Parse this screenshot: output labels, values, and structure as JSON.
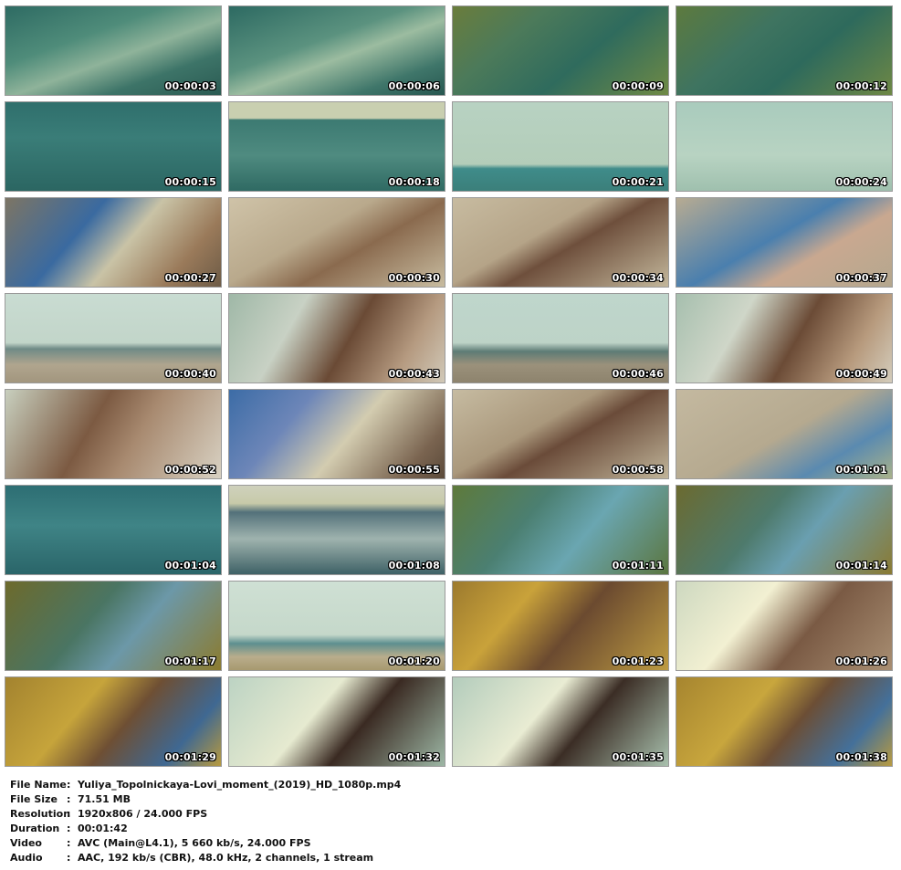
{
  "thumbnails": [
    {
      "timestamp": "00:00:03",
      "bg": "linear-gradient(160deg,#2e6b63 0%,#4f8c7a 35%,#8fb39a 55%,#3d7468 75%,#2a5a52 100%)"
    },
    {
      "timestamp": "00:00:06",
      "bg": "linear-gradient(160deg,#2d6a62 0%,#5b927f 40%,#9cbca0 55%,#3f766a 80%,#275750 100%)"
    },
    {
      "timestamp": "00:00:09",
      "bg": "linear-gradient(140deg,#6a7d3c 0%,#4c7a5a 30%,#2f6b5d 60%,#6f8a45 100%)"
    },
    {
      "timestamp": "00:00:12",
      "bg": "linear-gradient(140deg,#5d7a3e 0%,#3f7460 35%,#2e6a5c 60%,#6e8845 100%)"
    },
    {
      "timestamp": "00:00:15",
      "bg": "linear-gradient(180deg,#2f6f6c 0%,#3a7d78 40%,#2b6662 100%)"
    },
    {
      "timestamp": "00:00:18",
      "bg": "linear-gradient(180deg,#c9cfb0 0%,#c9cfb0 18%,#3c7a72 20%,#4f8b80 60%,#2f6a63 100%)"
    },
    {
      "timestamp": "00:00:21",
      "bg": "linear-gradient(180deg,#b8d2c2 0%,#b3cdb9 70%,#3f8c8a 75%,#3b7f7a 100%)"
    },
    {
      "timestamp": "00:00:24",
      "bg": "linear-gradient(180deg,#a9cbbd 0%,#b8d3c2 60%,#9fc0ae 100%)"
    },
    {
      "timestamp": "00:00:27",
      "bg": "linear-gradient(130deg,#7d7564 0%,#3a6aa0 35%,#c9c3a6 55%,#9a7a5a 80%,#6d5b46 100%)"
    },
    {
      "timestamp": "00:00:30",
      "bg": "linear-gradient(150deg,#cfc3a8 0%,#b9a98c 40%,#8a6a4e 60%,#c8bca0 100%)"
    },
    {
      "timestamp": "00:00:34",
      "bg": "linear-gradient(150deg,#c7bba0 0%,#b5a488 40%,#6e4f3c 55%,#c3b79b 100%)"
    },
    {
      "timestamp": "00:00:37",
      "bg": "linear-gradient(150deg,#b7ab92 0%,#4a7fae 45%,#c9a890 65%,#b4a78e 100%)"
    },
    {
      "timestamp": "00:00:40",
      "bg": "linear-gradient(180deg,#c9dcd2 0%,#c2d5c9 55%,#6f8a86 62%,#b0a58e 80%,#a2967e 100%)"
    },
    {
      "timestamp": "00:00:43",
      "bg": "linear-gradient(120deg,#9fb8a7 0%,#c8d1c4 30%,#6a4a35 55%,#b59a80 80%,#d1c9b8 100%)"
    },
    {
      "timestamp": "00:00:46",
      "bg": "linear-gradient(180deg,#bfd6cc 0%,#bdd3c7 55%,#5d7b75 65%,#9b917b 80%,#8d836d 100%)"
    },
    {
      "timestamp": "00:00:49",
      "bg": "linear-gradient(120deg,#a6bfae 0%,#cfd6c8 30%,#6b4b36 55%,#b79a7d 80%,#d4cdbc 100%)"
    },
    {
      "timestamp": "00:00:52",
      "bg": "linear-gradient(120deg,#c8cfbe 0%,#7c5a42 40%,#a88a70 60%,#d8d1c2 100%)"
    },
    {
      "timestamp": "00:00:55",
      "bg": "linear-gradient(130deg,#3c6ca6 0%,#6d86b8 30%,#d3ccb0 55%,#7a6450 85%,#5b4a3a 100%)"
    },
    {
      "timestamp": "00:00:58",
      "bg": "linear-gradient(150deg,#c6bba1 0%,#aa987c 40%,#6a4b39 55%,#c0b499 100%)"
    },
    {
      "timestamp": "00:01:01",
      "bg": "linear-gradient(150deg,#c4b9a0 0%,#b5a98f 50%,#5a8ab0 75%,#a9b28a 100%)"
    },
    {
      "timestamp": "00:01:04",
      "bg": "linear-gradient(180deg,#2d6e73 0%,#3f8486 45%,#2a6569 100%)"
    },
    {
      "timestamp": "00:01:08",
      "bg": "linear-gradient(180deg,#cfd1bd 0%,#c7caa9 20%,#53717a 30%,#9fb3ae 60%,#3e6166 100%)"
    },
    {
      "timestamp": "00:01:11",
      "bg": "linear-gradient(130deg,#5e7a3b 0%,#4b7f71 35%,#6aa6b1 60%,#5b7640 100%)"
    },
    {
      "timestamp": "00:01:14",
      "bg": "linear-gradient(130deg,#6b6a30 0%,#4e7a6c 40%,#6a9fb0 60%,#8a7a32 100%)"
    },
    {
      "timestamp": "00:01:17",
      "bg": "linear-gradient(130deg,#6d6a2c 0%,#4a7563 40%,#6c98a8 60%,#8b7b2f 100%)"
    },
    {
      "timestamp": "00:01:20",
      "bg": "linear-gradient(180deg,#cfe0d4 0%,#c5d8ca 60%,#5d8f8f 70%,#b9ad8c 85%,#a7996f 100%)"
    },
    {
      "timestamp": "00:01:23",
      "bg": "linear-gradient(130deg,#9c7a2e 0%,#c9a23a 30%,#6b4a30 55%,#bd9b41 100%)"
    },
    {
      "timestamp": "00:01:26",
      "bg": "linear-gradient(130deg,#cdd8c0 0%,#f2f0d2 35%,#7a5a44 60%,#a88e72 100%)"
    },
    {
      "timestamp": "00:01:29",
      "bg": "linear-gradient(130deg,#a3832f 0%,#c6a43b 35%,#6e4f34 55%,#3f6892 80%,#b89a3f 100%)"
    },
    {
      "timestamp": "00:01:32",
      "bg": "linear-gradient(130deg,#bcd3c3 0%,#e6ead0 40%,#3a2a22 60%,#9db7a5 100%)"
    },
    {
      "timestamp": "00:01:35",
      "bg": "linear-gradient(130deg,#b3ccbc 0%,#e9ecd3 40%,#3b2d25 60%,#a8c0ad 100%)"
    },
    {
      "timestamp": "00:01:38",
      "bg": "linear-gradient(130deg,#a6852f 0%,#c8a63d 35%,#6c4e35 55%,#44709a 80%,#b99b40 100%)"
    }
  ],
  "file_info": [
    {
      "label": "File Name",
      "value": "Yuliya_Topolnickaya-Lovi_moment_(2019)_HD_1080p.mp4"
    },
    {
      "label": "File Size",
      "value": "71.51 MB"
    },
    {
      "label": "Resolution",
      "value": "1920x806 / 24.000 FPS"
    },
    {
      "label": "Duration",
      "value": "00:01:42"
    },
    {
      "label": "Video",
      "value": "AVC (Main@L4.1), 5 660 kb/s, 24.000 FPS"
    },
    {
      "label": "Audio",
      "value": "AAC, 192 kb/s (CBR), 48.0 kHz, 2 channels, 1 stream"
    }
  ],
  "separator": ":"
}
